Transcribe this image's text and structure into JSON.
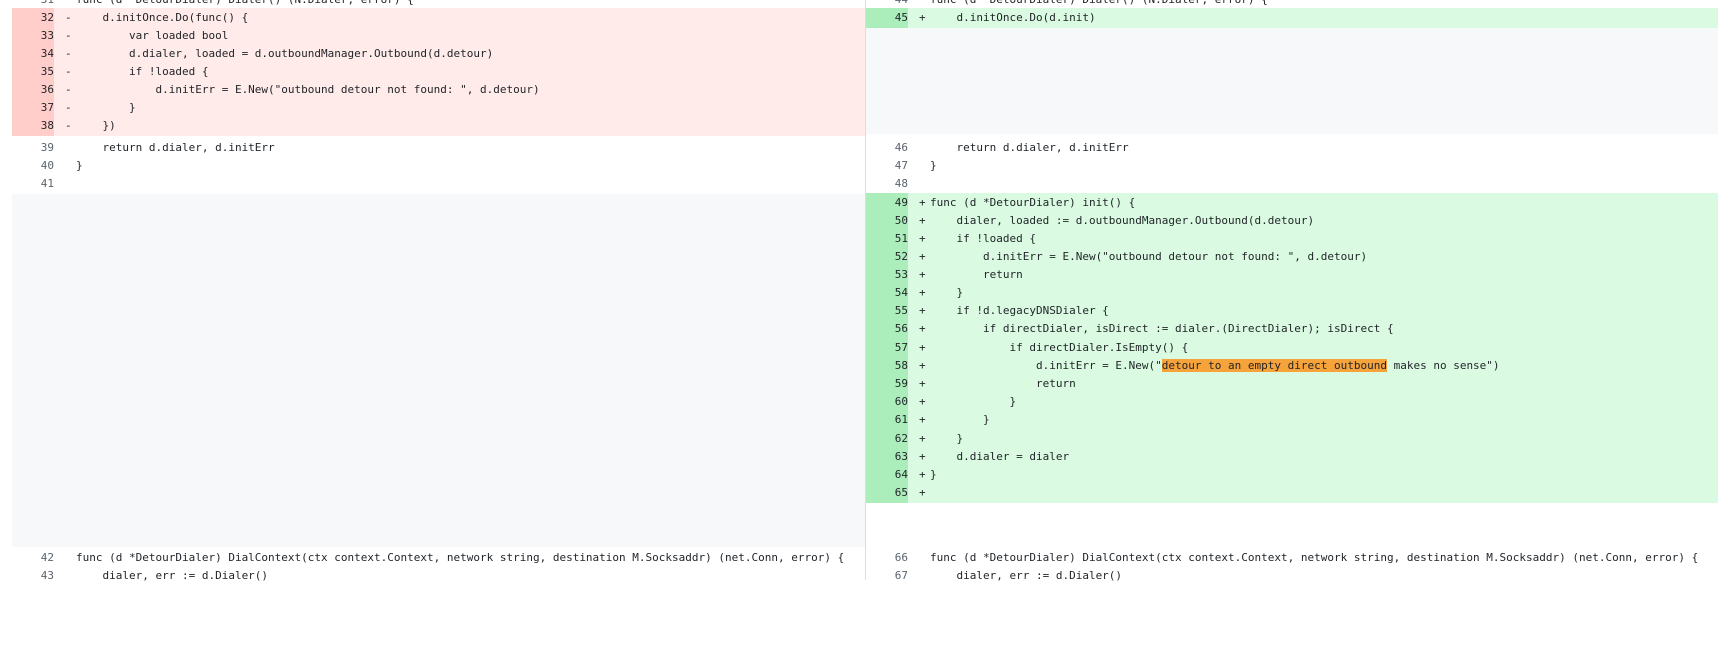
{
  "left": {
    "rows": [
      {
        "n": "31",
        "m": "",
        "kind": "ctx",
        "code": "func (d *DetourDialer) Dialer() (N.Dialer, error) {"
      },
      {
        "n": "32",
        "m": "-",
        "kind": "del",
        "code": "\td.initOnce.Do(func() {"
      },
      {
        "n": "33",
        "m": "-",
        "kind": "del",
        "code": "\t\tvar loaded bool"
      },
      {
        "n": "34",
        "m": "-",
        "kind": "del",
        "code": "\t\td.dialer, loaded = d.outboundManager.Outbound(d.detour)"
      },
      {
        "n": "35",
        "m": "-",
        "kind": "del",
        "code": "\t\tif !loaded {"
      },
      {
        "n": "36",
        "m": "-",
        "kind": "del",
        "code": "\t\t\td.initErr = E.New(\"outbound detour not found: \", d.detour)"
      },
      {
        "n": "37",
        "m": "-",
        "kind": "del",
        "code": "\t\t}"
      },
      {
        "n": "38",
        "m": "-",
        "kind": "del",
        "code": "\t})"
      },
      {
        "n": "39",
        "m": "",
        "kind": "ctx",
        "code": "\treturn d.dialer, d.initErr"
      },
      {
        "n": "40",
        "m": "",
        "kind": "ctx",
        "code": "}"
      },
      {
        "n": "41",
        "m": "",
        "kind": "ctx",
        "code": ""
      },
      {
        "n": "42",
        "m": "",
        "kind": "ctx",
        "code": "func (d *DetourDialer) DialContext(ctx context.Context, network string, destination M.Socksaddr) (net.Conn, error) {"
      },
      {
        "n": "43",
        "m": "",
        "kind": "ctx",
        "code": "\tdialer, err := d.Dialer()"
      }
    ]
  },
  "right": {
    "rows": [
      {
        "n": "44",
        "m": "",
        "kind": "ctx",
        "code": "func (d *DetourDialer) Dialer() (N.Dialer, error) {"
      },
      {
        "n": "45",
        "m": "+",
        "kind": "add",
        "code": "\td.initOnce.Do(d.init)"
      },
      {
        "n": "46",
        "m": "",
        "kind": "ctx",
        "code": "\treturn d.dialer, d.initErr"
      },
      {
        "n": "47",
        "m": "",
        "kind": "ctx",
        "code": "}"
      },
      {
        "n": "48",
        "m": "",
        "kind": "ctx",
        "code": ""
      },
      {
        "n": "49",
        "m": "+",
        "kind": "add",
        "code": "func (d *DetourDialer) init() {"
      },
      {
        "n": "50",
        "m": "+",
        "kind": "add",
        "code": "\tdialer, loaded := d.outboundManager.Outbound(d.detour)"
      },
      {
        "n": "51",
        "m": "+",
        "kind": "add",
        "code": "\tif !loaded {"
      },
      {
        "n": "52",
        "m": "+",
        "kind": "add",
        "code": "\t\td.initErr = E.New(\"outbound detour not found: \", d.detour)"
      },
      {
        "n": "53",
        "m": "+",
        "kind": "add",
        "code": "\t\treturn"
      },
      {
        "n": "54",
        "m": "+",
        "kind": "add",
        "code": "\t}"
      },
      {
        "n": "55",
        "m": "+",
        "kind": "add",
        "code": "\tif !d.legacyDNSDialer {"
      },
      {
        "n": "56",
        "m": "+",
        "kind": "add",
        "code": "\t\tif directDialer, isDirect := dialer.(DirectDialer); isDirect {"
      },
      {
        "n": "57",
        "m": "+",
        "kind": "add",
        "code": "\t\t\tif directDialer.IsEmpty() {"
      },
      {
        "n": "58",
        "m": "+",
        "kind": "add",
        "code_before": "\t\t\t\td.initErr = E.New(\"",
        "code_hl": "detour to an empty direct outbound",
        "code_after": " makes no sense\")"
      },
      {
        "n": "59",
        "m": "+",
        "kind": "add",
        "code": "\t\t\t\treturn"
      },
      {
        "n": "60",
        "m": "+",
        "kind": "add",
        "code": "\t\t\t}"
      },
      {
        "n": "61",
        "m": "+",
        "kind": "add",
        "code": "\t\t}"
      },
      {
        "n": "62",
        "m": "+",
        "kind": "add",
        "code": "\t}"
      },
      {
        "n": "63",
        "m": "+",
        "kind": "add",
        "code": "\td.dialer = dialer"
      },
      {
        "n": "64",
        "m": "+",
        "kind": "add",
        "code": "}"
      },
      {
        "n": "65",
        "m": "+",
        "kind": "add",
        "code": ""
      },
      {
        "n": "66",
        "m": "",
        "kind": "ctx",
        "code": "func (d *DetourDialer) DialContext(ctx context.Context, network string, destination M.Socksaddr) (net.Conn, error) {"
      },
      {
        "n": "67",
        "m": "",
        "kind": "ctx",
        "code": "\tdialer, err := d.Dialer()"
      }
    ]
  }
}
